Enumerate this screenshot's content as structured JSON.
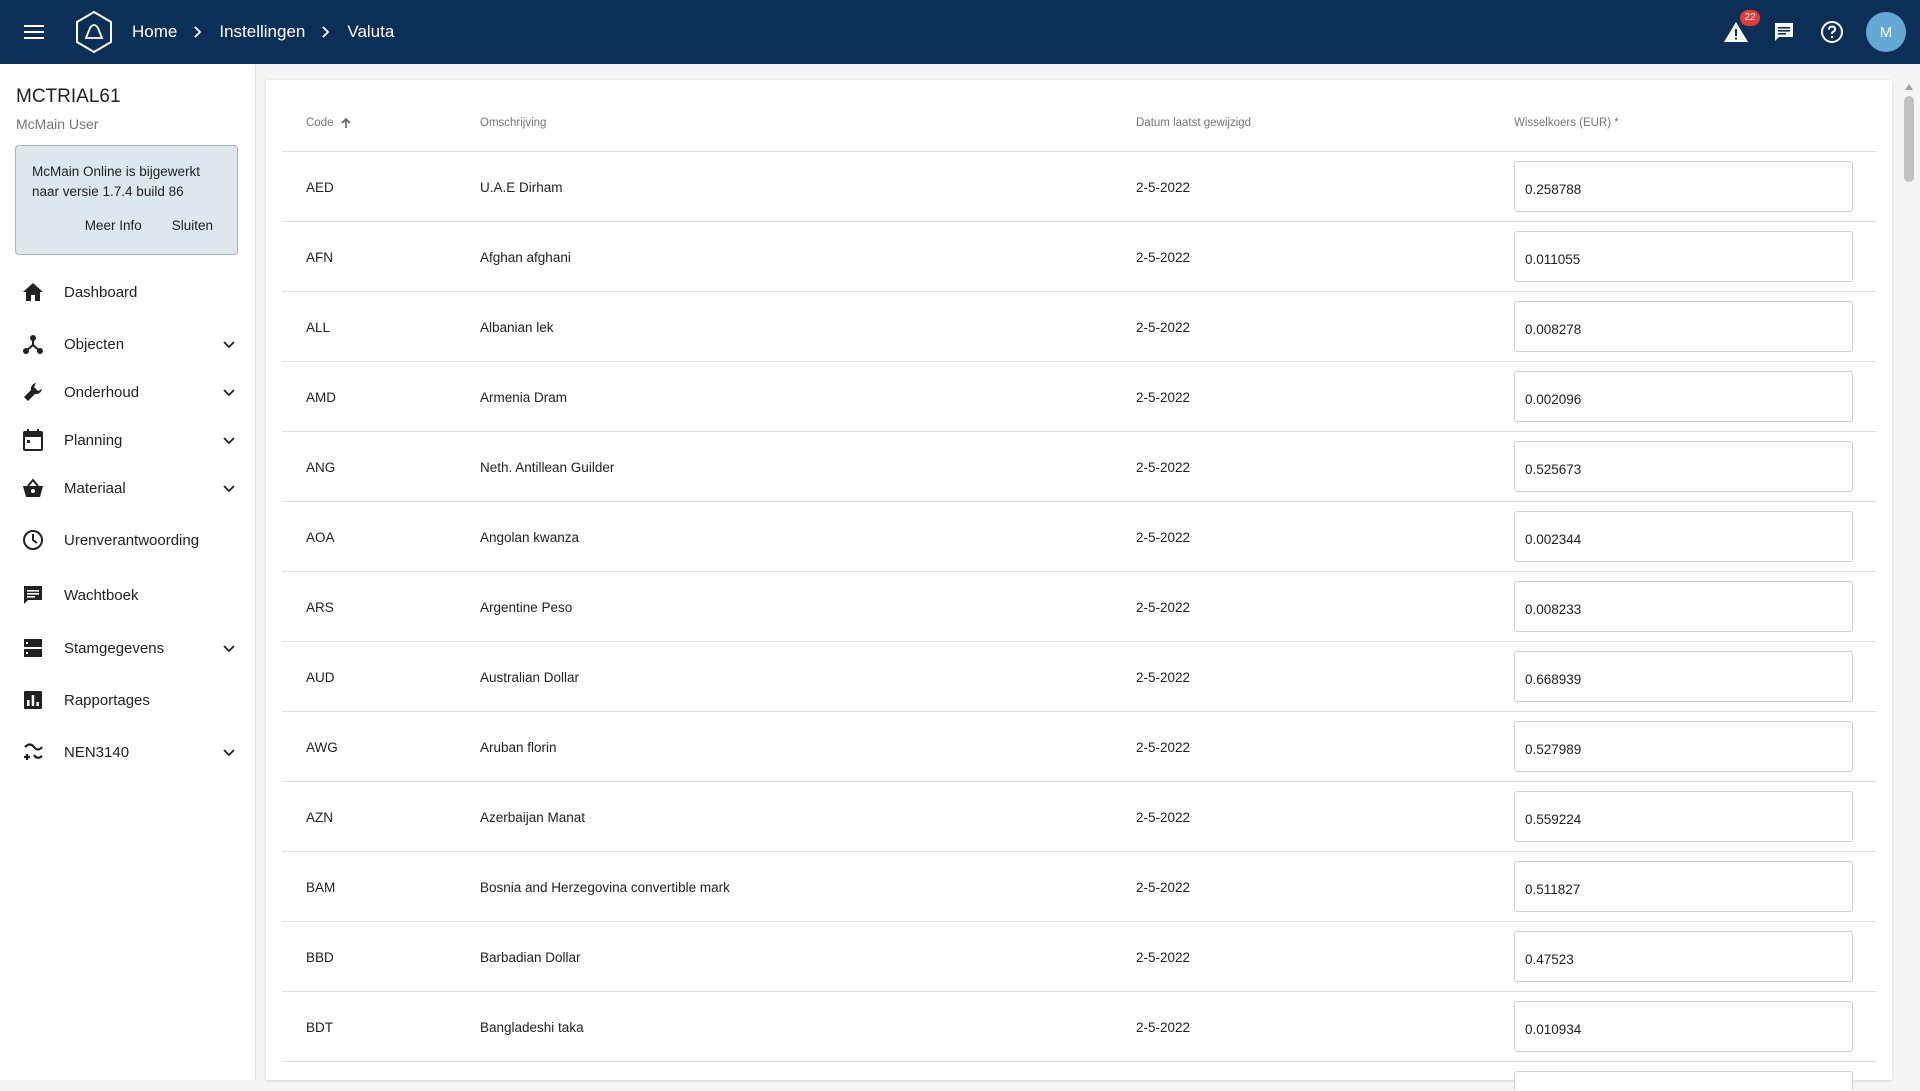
{
  "topbar": {
    "breadcrumb": [
      "Home",
      "Instellingen",
      "Valuta"
    ],
    "notifications_count": "22",
    "avatar_initial": "M"
  },
  "sidebar": {
    "tenant": "MCTRIAL61",
    "user": "McMain User",
    "notice": {
      "text": "McMain Online is bijgewerkt naar versie 1.7.4 build 86",
      "more_info": "Meer Info",
      "close": "Sluiten"
    },
    "items": [
      {
        "label": "Dashboard",
        "icon": "home-icon",
        "expandable": false
      },
      {
        "label": "Objecten",
        "icon": "objects-icon",
        "expandable": true
      },
      {
        "label": "Onderhoud",
        "icon": "wrench-icon",
        "expandable": true
      },
      {
        "label": "Planning",
        "icon": "calendar-icon",
        "expandable": true
      },
      {
        "label": "Materiaal",
        "icon": "basket-icon",
        "expandable": true
      },
      {
        "label": "Urenverantwoording",
        "icon": "clock-icon",
        "expandable": false
      },
      {
        "label": "Wachtboek",
        "icon": "message-icon",
        "expandable": false
      },
      {
        "label": "Stamgegevens",
        "icon": "storage-icon",
        "expandable": true
      },
      {
        "label": "Rapportages",
        "icon": "bar-chart-icon",
        "expandable": false
      },
      {
        "label": "NEN3140",
        "icon": "nen-icon",
        "expandable": true
      }
    ]
  },
  "table": {
    "headers": {
      "code": "Code",
      "description": "Omschrijving",
      "date": "Datum laatst gewijzigd",
      "rate": "Wisselkoers (EUR) *"
    },
    "rows": [
      {
        "code": "AED",
        "description": "U.A.E Dirham",
        "date": "2-5-2022",
        "rate": "0.258788"
      },
      {
        "code": "AFN",
        "description": "Afghan afghani",
        "date": "2-5-2022",
        "rate": "0.011055"
      },
      {
        "code": "ALL",
        "description": "Albanian lek",
        "date": "2-5-2022",
        "rate": "0.008278"
      },
      {
        "code": "AMD",
        "description": "Armenia Dram",
        "date": "2-5-2022",
        "rate": "0.002096"
      },
      {
        "code": "ANG",
        "description": "Neth. Antillean Guilder",
        "date": "2-5-2022",
        "rate": "0.525673"
      },
      {
        "code": "AOA",
        "description": "Angolan kwanza",
        "date": "2-5-2022",
        "rate": "0.002344"
      },
      {
        "code": "ARS",
        "description": "Argentine Peso",
        "date": "2-5-2022",
        "rate": "0.008233"
      },
      {
        "code": "AUD",
        "description": "Australian Dollar",
        "date": "2-5-2022",
        "rate": "0.668939"
      },
      {
        "code": "AWG",
        "description": "Aruban florin",
        "date": "2-5-2022",
        "rate": "0.527989"
      },
      {
        "code": "AZN",
        "description": "Azerbaijan Manat",
        "date": "2-5-2022",
        "rate": "0.559224"
      },
      {
        "code": "BAM",
        "description": "Bosnia and Herzegovina convertible mark",
        "date": "2-5-2022",
        "rate": "0.511827"
      },
      {
        "code": "BBD",
        "description": "Barbadian Dollar",
        "date": "2-5-2022",
        "rate": "0.47523"
      },
      {
        "code": "BDT",
        "description": "Bangladeshi taka",
        "date": "2-5-2022",
        "rate": "0.010934"
      }
    ]
  }
}
